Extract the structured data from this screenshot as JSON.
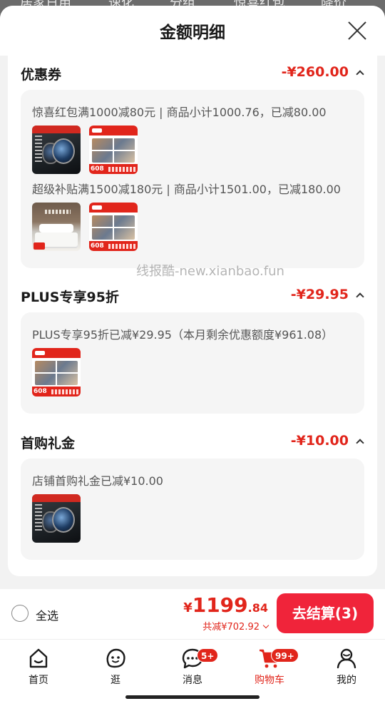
{
  "background_tabs": [
    "居家日用",
    "速化",
    "分组",
    "惊喜红包",
    "降价"
  ],
  "sheet": {
    "title": "金额明细",
    "close_icon": "close-icon"
  },
  "sections": [
    {
      "title": "优惠券",
      "amount": "-¥260.00",
      "lines": [
        "惊喜红包满1000减80元 | 商品小计1000.76，已减80.00",
        "超级补贴满1500减180元 | 商品小计1501.00，已减180.00"
      ],
      "thumb_sets": [
        {
          "badges": [
            "",
            "608"
          ],
          "kinds": [
            "watch",
            "food"
          ]
        },
        {
          "badges": [
            "",
            "608"
          ],
          "kinds": [
            "bed",
            "food"
          ]
        }
      ]
    },
    {
      "title": "PLUS专享95折",
      "amount": "-¥29.95",
      "lines": [
        "PLUS专享95折已减¥29.95（本月剩余优惠额度¥961.08）"
      ],
      "thumb_sets": [
        {
          "badges": [
            "608"
          ],
          "kinds": [
            "food"
          ]
        }
      ]
    },
    {
      "title": "首购礼金",
      "amount": "-¥10.00",
      "lines": [
        "店铺首购礼金已减¥10.00"
      ],
      "thumb_sets": [
        {
          "badges": [
            ""
          ],
          "kinds": [
            "watch"
          ]
        }
      ]
    }
  ],
  "watermark": "线报酷-new.xianbao.fun",
  "checkout": {
    "select_all": "全选",
    "currency": "¥",
    "total_int": "1199",
    "total_dec": ".84",
    "saved": "共减¥702.92",
    "pay_button": "去结算(3)"
  },
  "tabbar": {
    "items": [
      {
        "label": "首页",
        "icon": "home-icon",
        "badge": ""
      },
      {
        "label": "逛",
        "icon": "face-icon",
        "badge": ""
      },
      {
        "label": "消息",
        "icon": "message-icon",
        "badge": "5+"
      },
      {
        "label": "购物车",
        "icon": "cart-icon",
        "badge": "99+"
      },
      {
        "label": "我的",
        "icon": "user-icon",
        "badge": ""
      }
    ]
  },
  "colors": {
    "accent": "#e1251b",
    "pay_button": "#f0243a"
  }
}
